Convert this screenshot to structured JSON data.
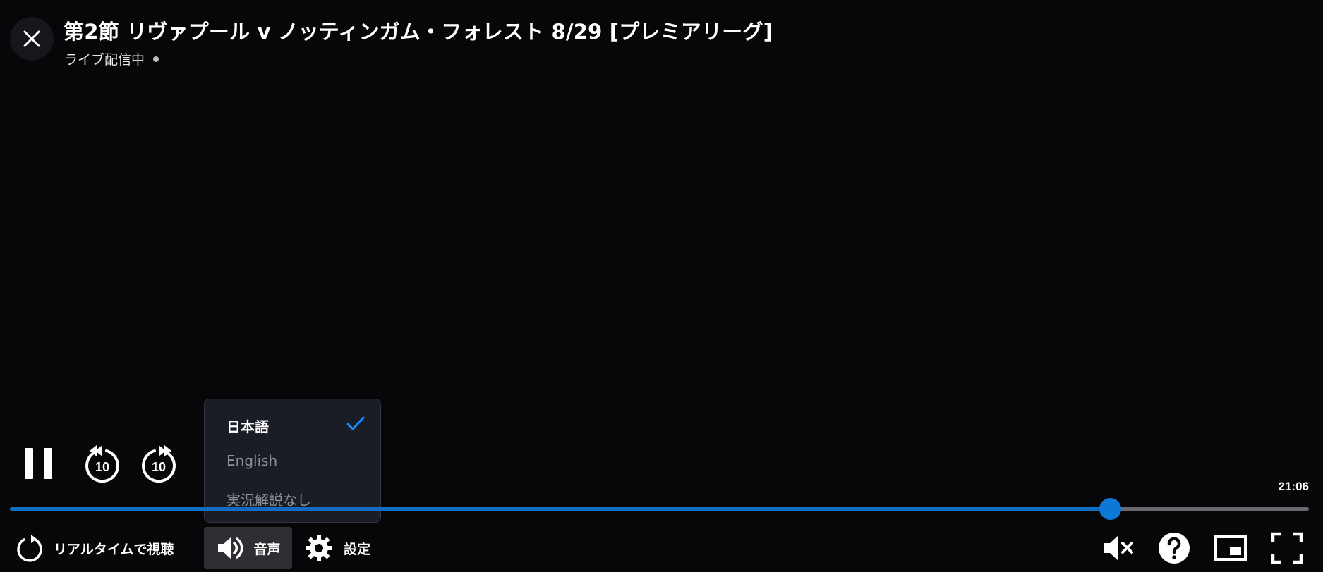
{
  "header": {
    "title": "第2節 リヴァプール v ノッティンガム・フォレスト 8/29 [プレミアリーグ]",
    "status": "ライブ配信中"
  },
  "audio_menu": {
    "items": [
      {
        "label": "日本語",
        "selected": true
      },
      {
        "label": "English",
        "selected": false
      },
      {
        "label": "実況解説なし",
        "selected": false
      }
    ]
  },
  "progress": {
    "time_label": "21:06",
    "played_fraction": 0.847
  },
  "controls": {
    "skip_back_seconds": "10",
    "skip_forward_seconds": "10",
    "realtime_label": "リアルタイムで視聴",
    "audio_label": "音声",
    "settings_label": "設定"
  },
  "colors": {
    "accent": "#0d78d6",
    "background": "#070709",
    "menu_background": "#1b1d26"
  },
  "icons": {
    "close": "close-icon",
    "pause": "pause-icon",
    "skip_back": "rewind-10-icon",
    "skip_forward": "forward-10-icon",
    "check": "check-icon",
    "realtime": "refresh-icon",
    "audio": "speaker-icon",
    "settings": "gear-icon",
    "mute": "speaker-muted-icon",
    "help": "help-icon",
    "pip": "picture-in-picture-icon",
    "fullscreen": "fullscreen-icon"
  }
}
